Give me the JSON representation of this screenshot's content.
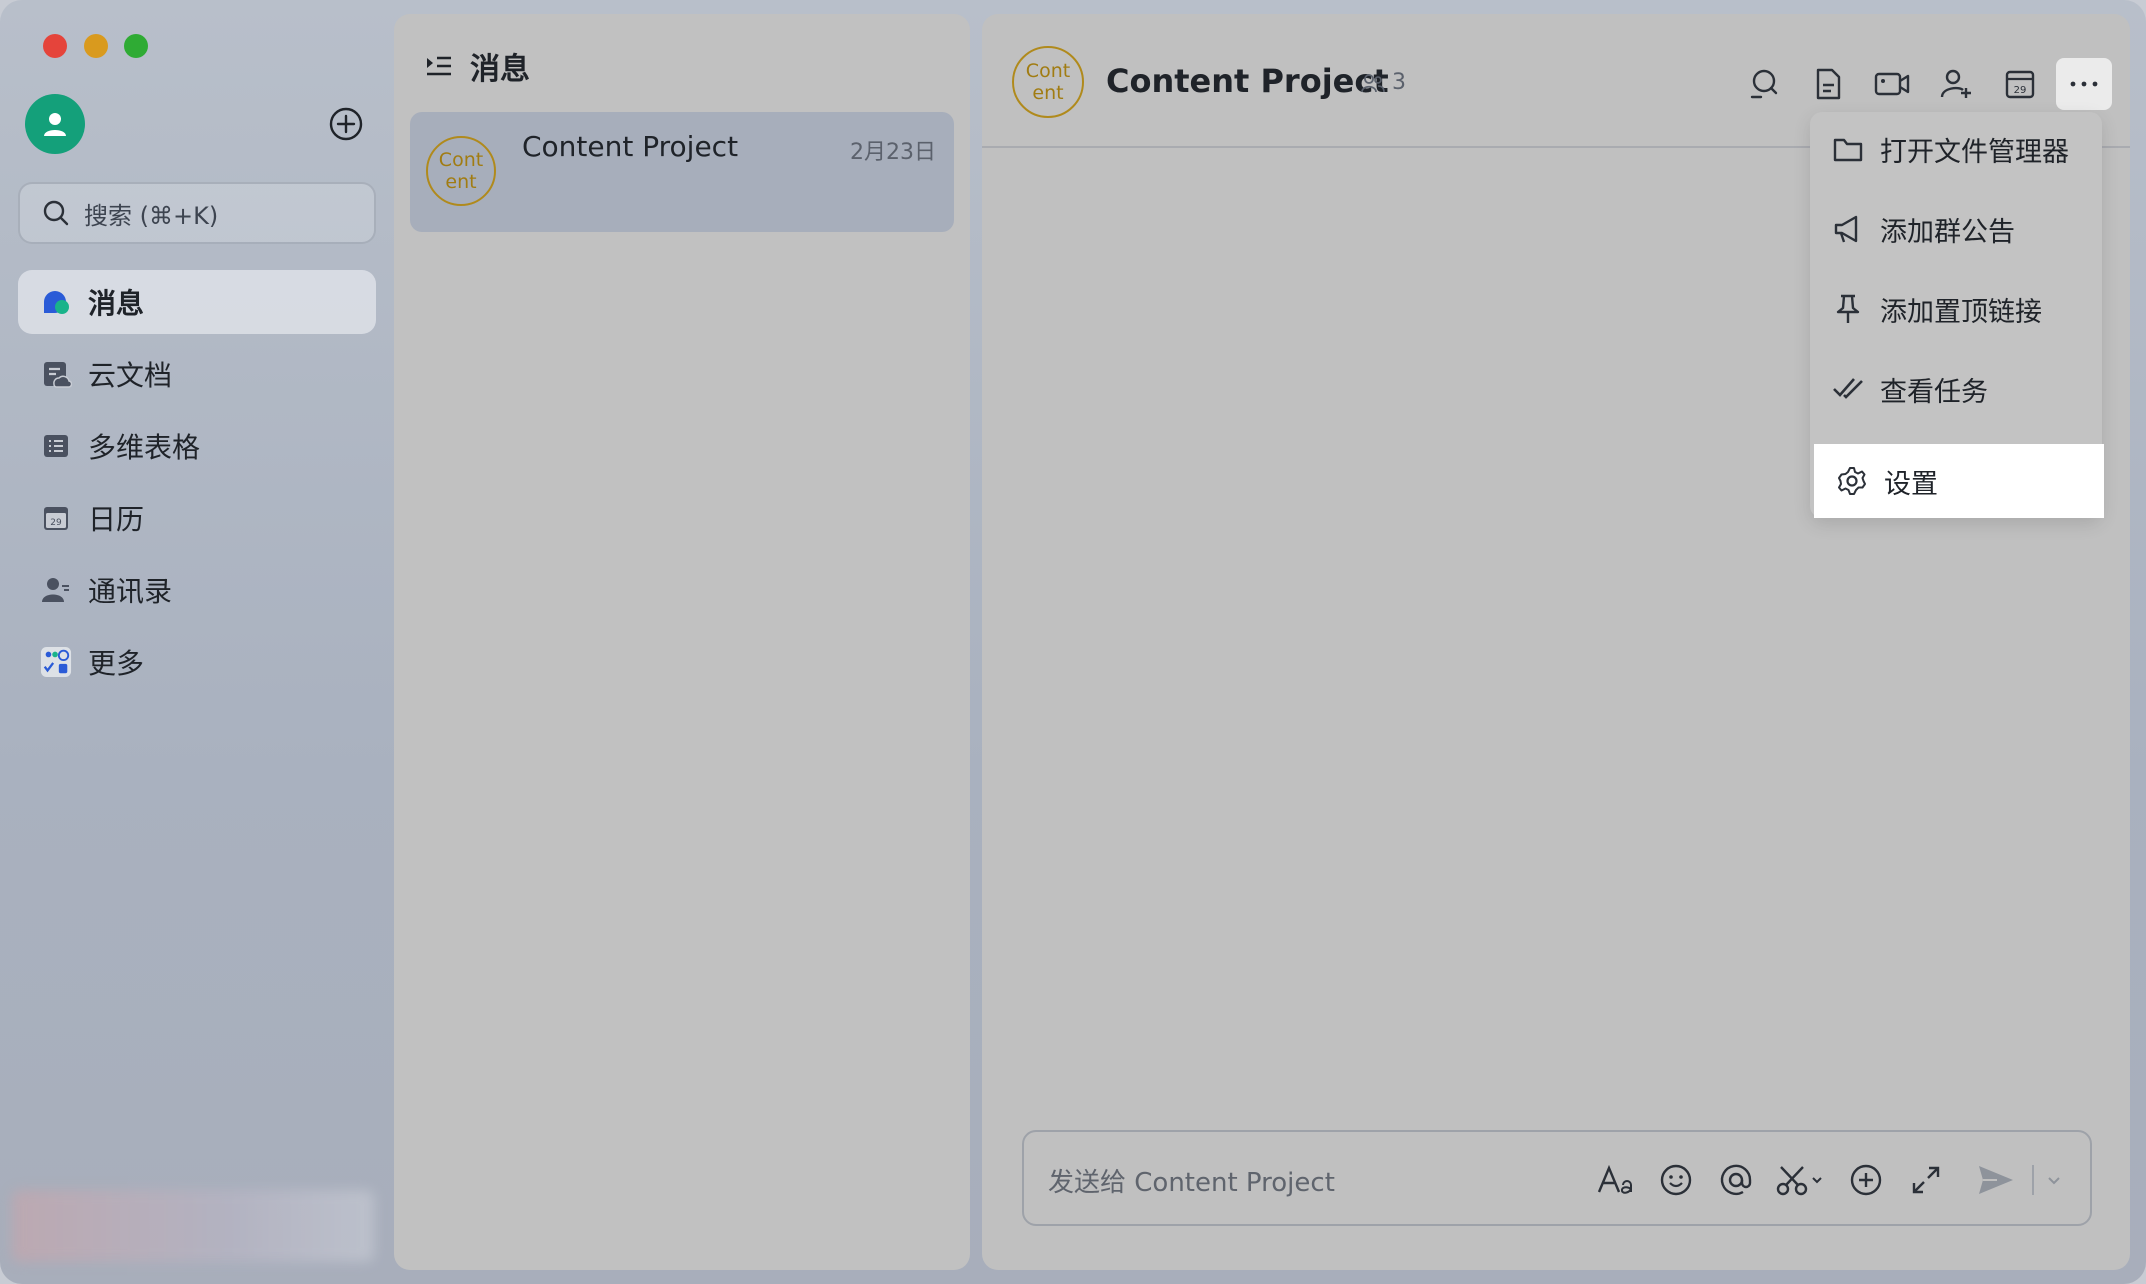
{
  "sidebar": {
    "search": {
      "placeholder": "搜索 (⌘+K)"
    },
    "nav": [
      {
        "label": "消息",
        "icon": "message-bubble-icon",
        "active": true
      },
      {
        "label": "云文档",
        "icon": "cloud-doc-icon"
      },
      {
        "label": "多维表格",
        "icon": "table-icon"
      },
      {
        "label": "日历",
        "icon": "calendar-icon"
      },
      {
        "label": "通讯录",
        "icon": "contacts-icon"
      },
      {
        "label": "更多",
        "icon": "apps-grid-icon"
      }
    ],
    "calendar_icon_day": "29"
  },
  "list": {
    "title": "消息",
    "conversations": [
      {
        "avatar_text": "Cont\nent",
        "name": "Content Project",
        "date": "2月23日"
      }
    ]
  },
  "chat": {
    "avatar_text": "Cont\nent",
    "title": "Content Project",
    "member_count": "3",
    "header_icons": [
      "search-icon",
      "doc-icon",
      "video-icon",
      "add-member-icon",
      "calendar-icon",
      "more-icon"
    ],
    "calendar_icon_day": "29",
    "composer_placeholder": "发送给 Content Project"
  },
  "menu": {
    "items": [
      {
        "label": "打开文件管理器",
        "icon": "folder-icon"
      },
      {
        "label": "添加群公告",
        "icon": "megaphone-icon"
      },
      {
        "label": "添加置顶链接",
        "icon": "pin-icon"
      },
      {
        "label": "查看任务",
        "icon": "task-check-icon"
      },
      {
        "label": "设置",
        "icon": "gear-icon",
        "hovered": true
      }
    ]
  },
  "colors": {
    "avatar_me": "#14a07a",
    "group_avatar_border": "#b08a1c",
    "active_nav_bg": "#e1e4ea"
  }
}
